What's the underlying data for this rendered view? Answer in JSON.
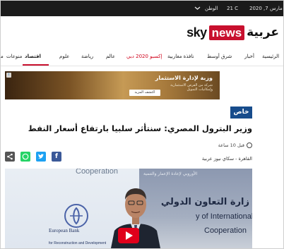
{
  "colors": {
    "brand_red": "#c8102e",
    "tag_blue": "#174c8c",
    "topbar_bg": "#1b1b1b"
  },
  "topbar": {
    "date": "2020 ,7 مارس",
    "weather": "21 C",
    "weather_city": "الوطن",
    "dropdown_icon": "chevron-down-icon"
  },
  "logo": {
    "sky": "sky",
    "news": "news",
    "arabic": "عربية"
  },
  "nav": {
    "items": [
      {
        "label": "الرئيسية"
      },
      {
        "label": "أخبار"
      },
      {
        "label": "شرق أوسط"
      },
      {
        "label": "نافذة مغاربية"
      },
      {
        "label": "إكسبو 2020 دبي"
      },
      {
        "label": "عالم"
      },
      {
        "label": "رياضة"
      },
      {
        "label": "علوم"
      },
      {
        "label": "اقتصاد"
      },
      {
        "label": "منوعات"
      },
      {
        "label": "مـ"
      }
    ],
    "active": "اقتصاد"
  },
  "ad": {
    "title": "وزبة لإدارة الاستثمار",
    "subtitle": "شركة من الفرص الاستثمارية وإمكانيات التمويل",
    "button": "اكتشف المزيد",
    "info_icon": "ad-info-icon"
  },
  "article": {
    "tag": "خاص",
    "headline": "وزير البترول المصري: سنتأثر سلبيا بارتفاع أسعار النفط",
    "time": "قبل 10 ساعة",
    "byline": "القاهرة - سكاي نيوز عربية",
    "share": [
      "facebook",
      "twitter",
      "whatsapp",
      "share"
    ]
  },
  "video": {
    "bg_word_top": "Cooperation",
    "ebrd_line1": "European Bank",
    "ebrd_line2": "for Reconstruction and Development",
    "arabic_top": "الأوروبي لإعادة الإعمار والتنمية",
    "arabic_big": "زارة التعاون الدولي",
    "english_big": "y of International",
    "english_big2": "Cooperation"
  }
}
